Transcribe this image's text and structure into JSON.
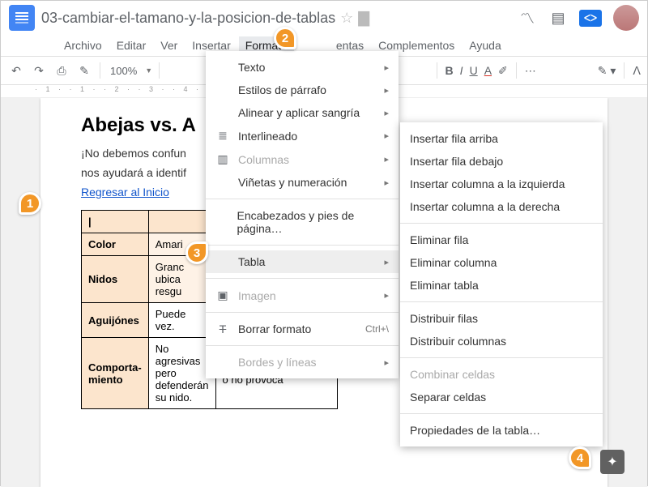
{
  "header": {
    "doc_title": "03-cambiar-el-tamano-y-la-posicion-de-tablas",
    "share_label": "ᐸᐳ"
  },
  "menubar": {
    "items": [
      "Archivo",
      "Editar",
      "Ver",
      "Insertar",
      "Formato",
      "",
      "",
      "entas",
      "Complementos",
      "Ayuda"
    ],
    "active_index": 4
  },
  "toolbar": {
    "zoom": "100%"
  },
  "document": {
    "heading": "Abejas vs. A",
    "para1": "¡No debemos confun",
    "para2": "nos ayudará a identif",
    "link": "Regresar al Inicio",
    "table": {
      "rows": [
        {
          "label": "",
          "c1": "",
          "c2": ""
        },
        {
          "label": "Color",
          "c1": "Amari",
          "c2": ""
        },
        {
          "label": "Nidos",
          "c1": "Granc\nubica\nresgu",
          "c2": ""
        },
        {
          "label": "Aguijónes",
          "c1": "Puede\nvez.",
          "c2": ""
        },
        {
          "label": "Comporta-\nmiento",
          "c1": "No agresivas pero\ndefenderán su nido.",
          "c2": "Muy agresivas\no no provoca"
        }
      ]
    }
  },
  "format_menu": {
    "items": [
      {
        "label": "Texto",
        "arrow": true
      },
      {
        "label": "Estilos de párrafo",
        "arrow": true
      },
      {
        "label": "Alinear y aplicar sangría",
        "arrow": true
      },
      {
        "label": "Interlineado",
        "icon": "line-spacing",
        "arrow": true
      },
      {
        "label": "Columnas",
        "icon": "columns",
        "arrow": true,
        "dis": true
      },
      {
        "label": "Viñetas y numeración",
        "arrow": true
      },
      {
        "hr": true
      },
      {
        "label": "Encabezados y pies de página…"
      },
      {
        "hr": true
      },
      {
        "label": "Tabla",
        "arrow": true,
        "hi": true
      },
      {
        "hr": true
      },
      {
        "label": "Imagen",
        "icon": "image",
        "arrow": true,
        "dis": true
      },
      {
        "hr": true
      },
      {
        "label": "Borrar formato",
        "icon": "clear-format",
        "shortcut": "Ctrl+\\"
      },
      {
        "hr": true
      },
      {
        "label": "Bordes y líneas",
        "arrow": true,
        "dis": true
      }
    ]
  },
  "table_submenu": {
    "groups": [
      [
        "Insertar fila arriba",
        "Insertar fila debajo",
        "Insertar columna a la izquierda",
        "Insertar columna a la derecha"
      ],
      [
        "Eliminar fila",
        "Eliminar columna",
        "Eliminar tabla"
      ],
      [
        "Distribuir filas",
        "Distribuir columnas"
      ],
      [
        "Combinar celdas",
        "Separar celdas"
      ],
      [
        "Propiedades de la tabla…"
      ]
    ],
    "disabled": [
      "Combinar celdas"
    ]
  },
  "badges": {
    "1": "1",
    "2": "2",
    "3": "3",
    "4": "4"
  }
}
